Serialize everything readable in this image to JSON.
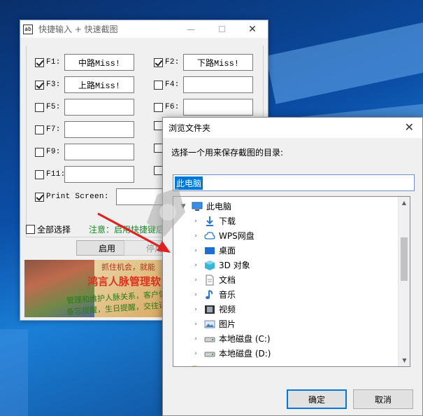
{
  "app_window": {
    "title": "快捷输入 + 快速截图",
    "icon_text": "ab",
    "hotkeys": [
      {
        "key": "F1:",
        "checked": true,
        "value": "中路Miss!"
      },
      {
        "key": "F2:",
        "checked": true,
        "value": "下路Miss!"
      },
      {
        "key": "F3:",
        "checked": true,
        "value": "上路Miss!"
      },
      {
        "key": "F4:",
        "checked": false,
        "value": ""
      },
      {
        "key": "F5:",
        "checked": false,
        "value": ""
      },
      {
        "key": "F6:",
        "checked": false,
        "value": ""
      },
      {
        "key": "F7:",
        "checked": false,
        "value": ""
      },
      {
        "key": "F9:",
        "checked": false,
        "value": ""
      },
      {
        "key": "F11:",
        "checked": false,
        "value": ""
      }
    ],
    "print_screen_label": "Print Screen:",
    "select_all_label": "全部选择",
    "notice_text": "注意：启用快捷键后",
    "enable_button": "启用",
    "disable_button": "停用",
    "banner": {
      "line1": "抓住机会，就能",
      "line2": "鸿言人脉管理软",
      "line3": "管理和维护人脉关系，客户信息，社",
      "line4": "备忘提醒，生日提醒，交往记录，图"
    }
  },
  "browse_dialog": {
    "title": "浏览文件夹",
    "prompt": "选择一个用来保存截图的目录:",
    "path_value": "此电脑",
    "tree": [
      {
        "label": "此电脑",
        "icon": "computer-icon",
        "expanded": true
      },
      {
        "label": "下载",
        "icon": "download-folder-icon"
      },
      {
        "label": "WPS网盘",
        "icon": "cloud-icon"
      },
      {
        "label": "桌面",
        "icon": "desktop-icon"
      },
      {
        "label": "3D 对象",
        "icon": "3d-objects-icon"
      },
      {
        "label": "文档",
        "icon": "document-icon"
      },
      {
        "label": "音乐",
        "icon": "music-icon"
      },
      {
        "label": "视频",
        "icon": "video-icon"
      },
      {
        "label": "图片",
        "icon": "pictures-icon"
      },
      {
        "label": "本地磁盘 (C:)",
        "icon": "drive-icon"
      },
      {
        "label": "本地磁盘 (D:)",
        "icon": "drive-icon"
      }
    ],
    "ok_button": "确定",
    "cancel_button": "取消"
  },
  "colors": {
    "accent": "#0078d7",
    "notice_green": "#1a8a2a",
    "arrow_red": "#e02020"
  }
}
